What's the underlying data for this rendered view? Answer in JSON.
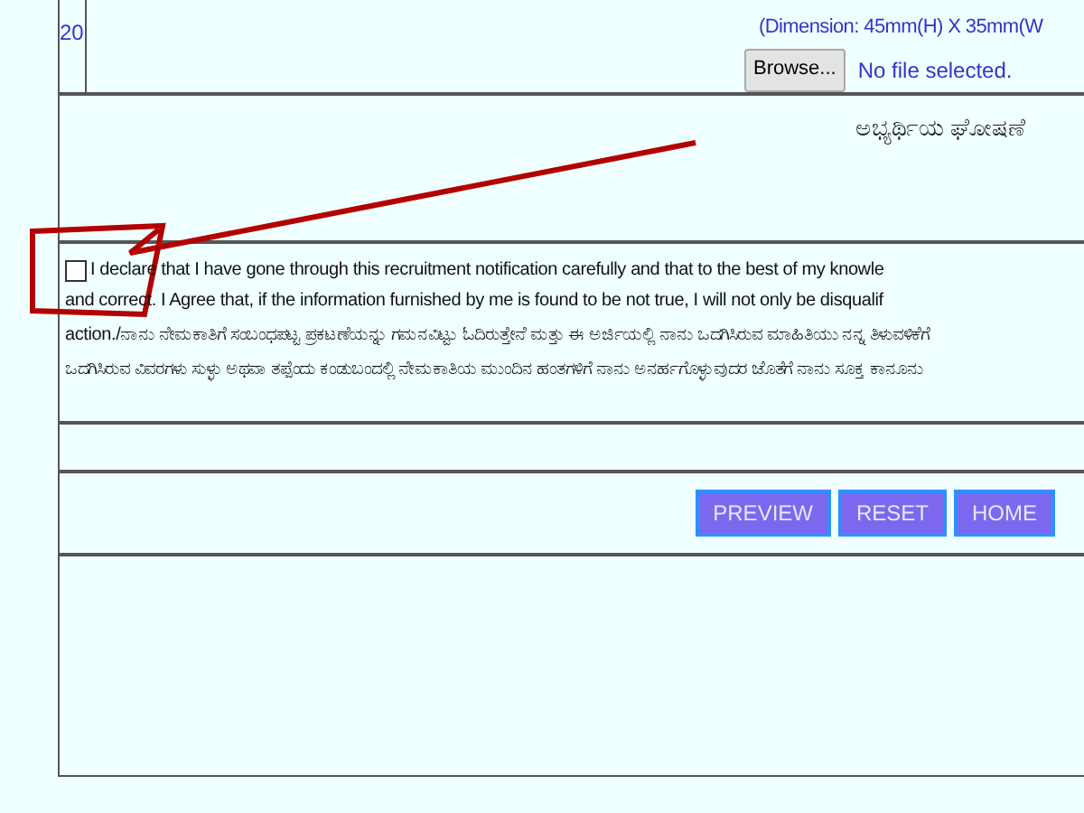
{
  "upload_row": {
    "number": "20",
    "dimension": "(Dimension: 45mm(H) X 35mm(W",
    "browse_button": "Browse...",
    "file_status": "No file selected."
  },
  "declaration": {
    "title": "ಅಭ್ಯರ್ಥಿಯ ಘೋಷಣೆ",
    "checked": false,
    "lines": [
      "I declare that I have gone through this recruitment notification carefully and that to the best of my knowle",
      "and correct. I Agree that, if the information furnished by me is found to be not true, I will not only be disqualif",
      "action./ನಾನು ನೇಮಕಾತಿಗೆ ಸಂಬಂಧಪಟ್ಟ ಪ್ರಕಟಣೆಯನ್ನು ಗಮನವಿಟ್ಟು ಓದಿರುತ್ತೇನೆ ಮತ್ತು ಈ ಅರ್ಜಿಯಲ್ಲಿ ನಾನು ಒದಗಿಸಿರುವ ಮಾಹಿತಿಯು ನನ್ನ ತಿಳುವಳಿಕೆಗೆ",
      "ಒದಗಿಸಿರುವ ವಿವರಗಳು ಸುಳ್ಳು ಅಥವಾ ತಪ್ಪೆಂದು ಕಂಡುಬಂದಲ್ಲಿ ನೇಮಕಾತಿಯ ಮುಂದಿನ ಹಂತಗಳಿಗೆ ನಾನು ಅನರ್ಹಗೊಳ್ಳುವುದರ ಜೊತೆಗೆ ನಾನು ಸೂಕ್ತ ಕಾನೂನು"
    ]
  },
  "buttons": [
    "PREVIEW",
    "RESET",
    "HOME"
  ]
}
